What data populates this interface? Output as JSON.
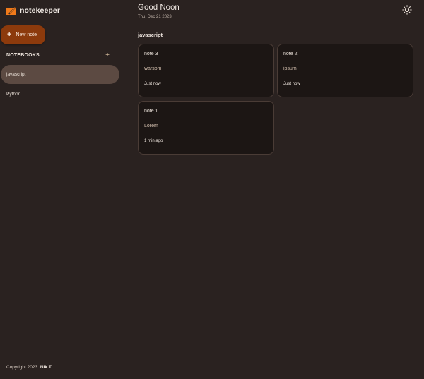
{
  "brand": {
    "name": "notekeeper",
    "logo_icon": "notebook-pen-icon",
    "accent": "#f07a1a"
  },
  "sidebar": {
    "new_note_label": "New note",
    "new_note_icon": "plus-icon",
    "notebooks_title": "NOTEBOOKS",
    "add_notebook_label": "+",
    "notebooks": [
      {
        "label": "javascript",
        "active": true
      },
      {
        "label": "Python",
        "active": false
      }
    ],
    "copyright_prefix": "Copyright 2023",
    "copyright_author": "Nik T."
  },
  "header": {
    "greeting": "Good Noon",
    "date": "Thu, Dec 21 2023",
    "theme_toggle_icon": "sun-icon"
  },
  "main": {
    "section_title": "javascript",
    "notes": [
      {
        "title": "note 3",
        "body": "warsom",
        "time": "Just now"
      },
      {
        "title": "note 2",
        "body": "ipsum",
        "time": "Just now"
      },
      {
        "title": "note 1",
        "body": "Lorem",
        "time": "1 min ago"
      }
    ]
  },
  "colors": {
    "background": "#2a2220",
    "card": "#1c1614",
    "active_notebook": "#5c4a42",
    "primary_button": "#8c3a0c"
  }
}
